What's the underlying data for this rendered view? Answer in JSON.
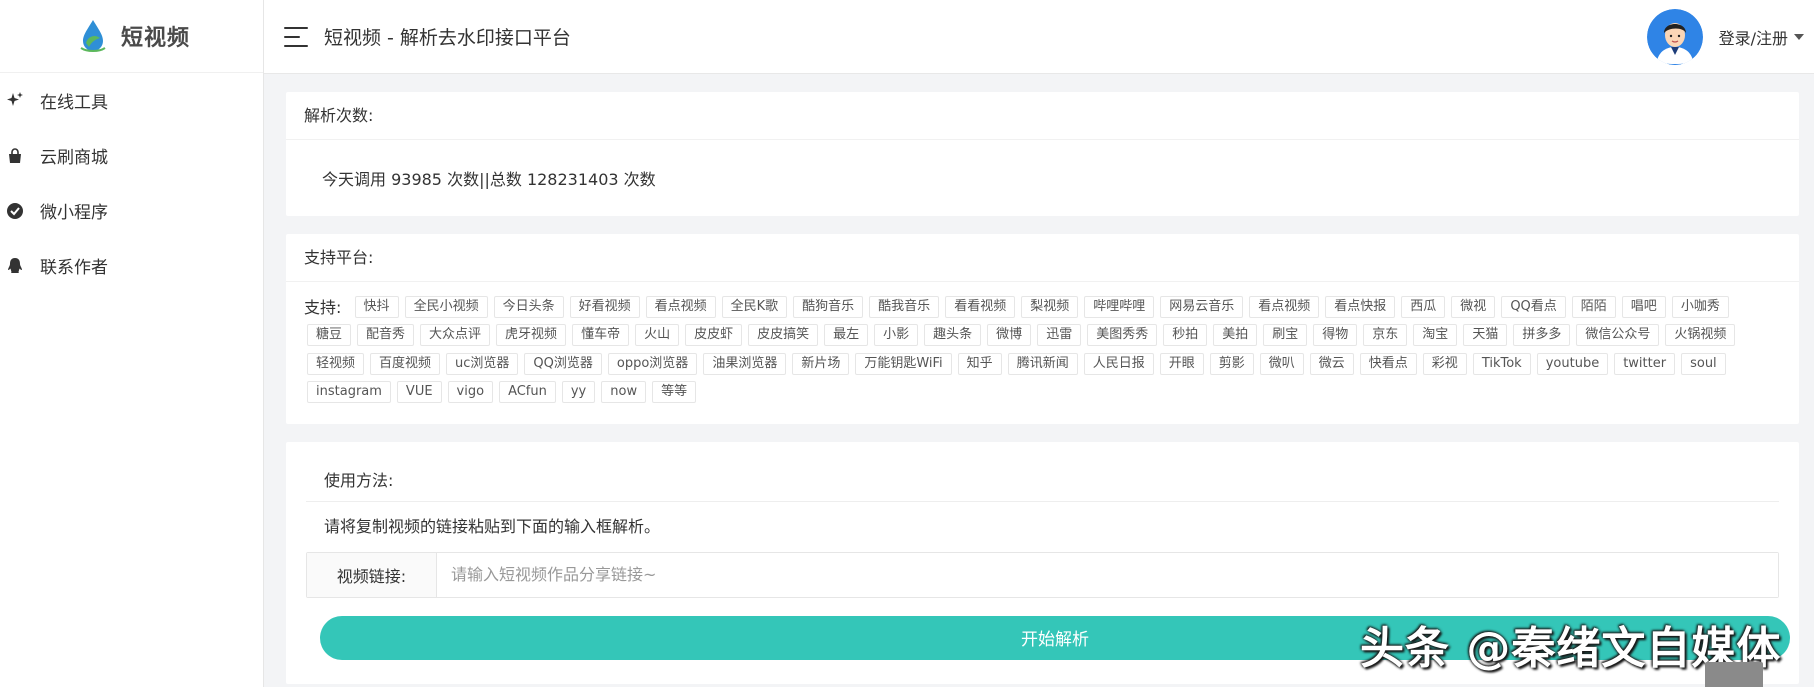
{
  "logo": {
    "text": "短视频",
    "icon": "water-drop-leaf-icon",
    "accent": "#2f8fd6",
    "leaf": "#5cb85c"
  },
  "sidebar": {
    "items": [
      {
        "label": "在线工具",
        "icon": "sparkle-icon"
      },
      {
        "label": "云刷商城",
        "icon": "shopping-bag-icon"
      },
      {
        "label": "微小程序",
        "icon": "check-circle-icon"
      },
      {
        "label": "联系作者",
        "icon": "qq-penguin-icon"
      }
    ]
  },
  "header": {
    "title": "短视频 - 解析去水印接口平台",
    "login_label": "登录/注册",
    "avatar_icon": "user-avatar-icon"
  },
  "stats": {
    "title": "解析次数:",
    "text": "今天调用 93985 次数||总数 128231403 次数"
  },
  "platforms": {
    "title": "支持平台:",
    "label": "支持:",
    "tags": [
      "快抖",
      "全民小视频",
      "今日头条",
      "好看视频",
      "看点视频",
      "全民K歌",
      "酷狗音乐",
      "酷我音乐",
      "看看视频",
      "梨视频",
      "哔哩哔哩",
      "网易云音乐",
      "看点视频",
      "看点快报",
      "西瓜",
      "微视",
      "QQ看点",
      "陌陌",
      "唱吧",
      "小咖秀",
      "糖豆",
      "配音秀",
      "大众点评",
      "虎牙视频",
      "懂车帝",
      "火山",
      "皮皮虾",
      "皮皮搞笑",
      "最左",
      "小影",
      "趣头条",
      "微博",
      "迅雷",
      "美图秀秀",
      "秒拍",
      "美拍",
      "刷宝",
      "得物",
      "京东",
      "淘宝",
      "天猫",
      "拼多多",
      "微信公众号",
      "火锅视频",
      "轻视频",
      "百度视频",
      "uc浏览器",
      "QQ浏览器",
      "oppo浏览器",
      "油果浏览器",
      "新片场",
      "万能钥匙WiFi",
      "知乎",
      "腾讯新闻",
      "人民日报",
      "开眼",
      "剪影",
      "微叭",
      "微云",
      "快看点",
      "彩视",
      "TikTok",
      "youtube",
      "twitter",
      "soul",
      "instagram",
      "VUE",
      "vigo",
      "ACfun",
      "yy",
      "now",
      "等等"
    ]
  },
  "usage": {
    "title": "使用方法:",
    "description": "请将复制视频的链接粘贴到下面的输入框解析。",
    "input_label": "视频链接:",
    "input_placeholder": "请输入短视频作品分享链接~",
    "input_value": "",
    "button_label": "开始解析",
    "button_color": "#34c6b8"
  },
  "watermark": {
    "text": "头条 @秦绪文自媒体"
  }
}
